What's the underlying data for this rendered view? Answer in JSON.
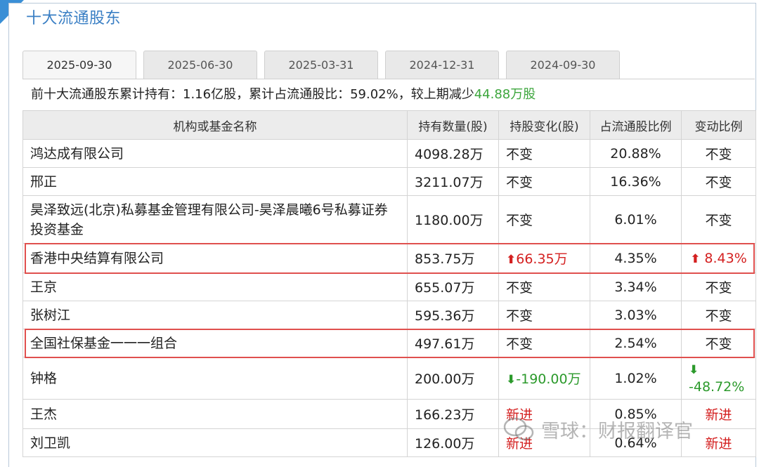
{
  "panel": {
    "title": "十大流通股东"
  },
  "tabs": [
    {
      "label": "2025-09-30",
      "active": true
    },
    {
      "label": "2025-06-30",
      "active": false
    },
    {
      "label": "2025-03-31",
      "active": false
    },
    {
      "label": "2024-12-31",
      "active": false
    },
    {
      "label": "2024-09-30",
      "active": false
    }
  ],
  "summary": {
    "text": "前十大流通股东累计持有：1.16亿股，累计占流通股比：59.02%，较上期减少",
    "decrease_value": "44.88万股"
  },
  "table": {
    "headers": [
      "机构或基金名称",
      "持有数量(股)",
      "持股变化(股)",
      "占流通股比例",
      "变动比例"
    ],
    "rows": [
      {
        "name": "鸿达成有限公司",
        "shares": "4098.28万",
        "change": "不变",
        "change_type": "none",
        "pct": "20.88%",
        "ratio": "不变",
        "ratio_type": "none"
      },
      {
        "name": "邢正",
        "shares": "3211.07万",
        "change": "不变",
        "change_type": "none",
        "pct": "16.36%",
        "ratio": "不变",
        "ratio_type": "none"
      },
      {
        "name": "昊泽致远(北京)私募基金管理有限公司-昊泽晨曦6号私募证券投资基金",
        "shares": "1180.00万",
        "change": "不变",
        "change_type": "none",
        "pct": "6.01%",
        "ratio": "不变",
        "ratio_type": "none"
      },
      {
        "name": "香港中央结算有限公司",
        "shares": "853.75万",
        "change": "66.35万",
        "change_type": "up",
        "pct": "4.35%",
        "ratio": "8.43%",
        "ratio_type": "up"
      },
      {
        "name": "王京",
        "shares": "655.07万",
        "change": "不变",
        "change_type": "none",
        "pct": "3.34%",
        "ratio": "不变",
        "ratio_type": "none"
      },
      {
        "name": "张树江",
        "shares": "595.36万",
        "change": "不变",
        "change_type": "none",
        "pct": "3.03%",
        "ratio": "不变",
        "ratio_type": "none"
      },
      {
        "name": "全国社保基金一一一组合",
        "shares": "497.61万",
        "change": "不变",
        "change_type": "none",
        "pct": "2.54%",
        "ratio": "不变",
        "ratio_type": "none"
      },
      {
        "name": "钟格",
        "shares": "200.00万",
        "change": "-190.00万",
        "change_type": "down",
        "pct": "1.02%",
        "ratio": "-48.72%",
        "ratio_type": "down"
      },
      {
        "name": "王杰",
        "shares": "166.23万",
        "change": "新进",
        "change_type": "new",
        "pct": "0.85%",
        "ratio": "新进",
        "ratio_type": "new"
      },
      {
        "name": "刘卫凯",
        "shares": "126.00万",
        "change": "新进",
        "change_type": "new",
        "pct": "0.64%",
        "ratio": "新进",
        "ratio_type": "new"
      }
    ]
  },
  "highlight_rows": [
    3,
    6
  ],
  "colors": {
    "accent": "#3a7fc4",
    "up": "#d42020",
    "down": "#2c9a2c",
    "highlight": "#e0504e"
  },
  "icons": {
    "up": "arrow-up-icon",
    "down": "arrow-down-icon"
  },
  "watermark": {
    "text": "雪球：财报翻译官"
  }
}
